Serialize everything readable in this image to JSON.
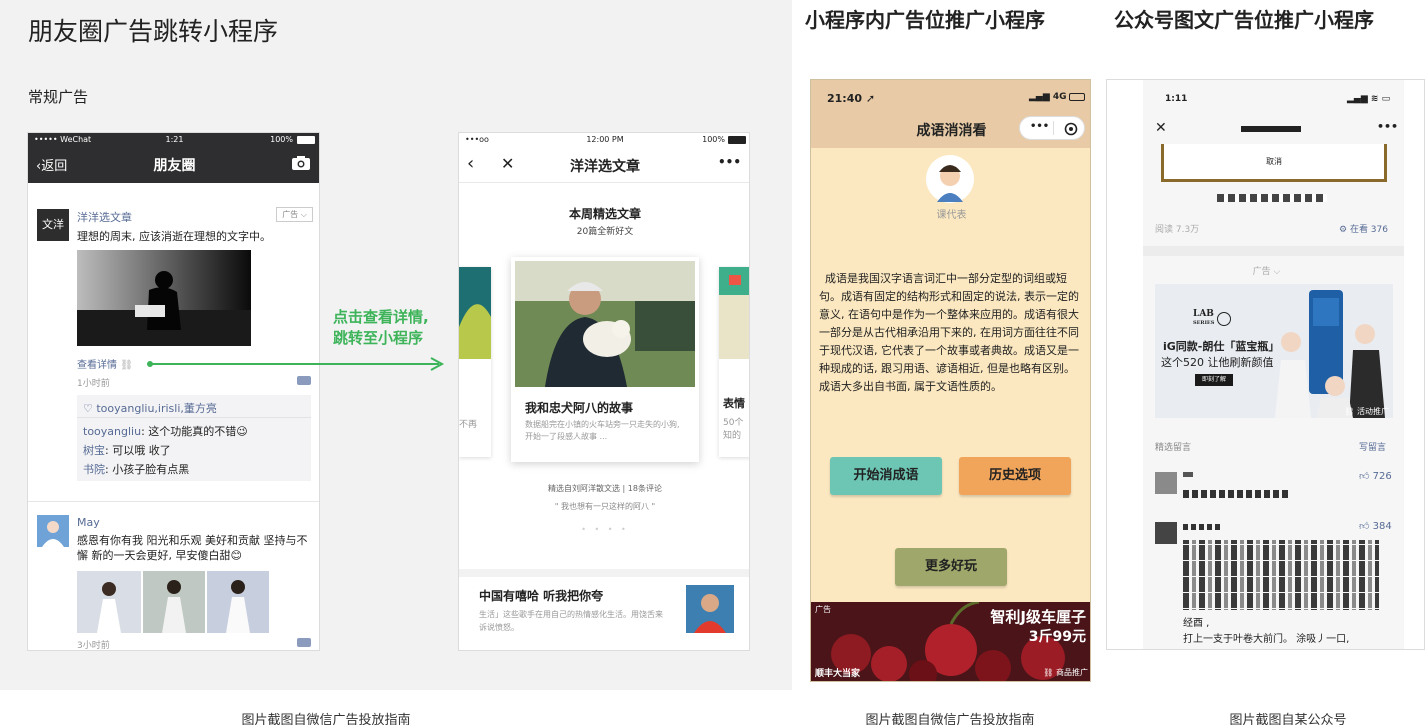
{
  "main_title": "朋友圈广告跳转小程序",
  "sub_title": "常规广告",
  "arrow_text": [
    "点击查看详情,",
    "跳转至小程序"
  ],
  "heading_miniprogram": "小程序内广告位推广小程序",
  "heading_official": "公众号图文广告位推广小程序",
  "captions": [
    "图片截图自微信广告投放指南",
    "图片截图自微信广告投放指南",
    "图片截图自某公众号"
  ],
  "phone1": {
    "status_carrier": "••••• WeChat",
    "status_time": "1:21",
    "status_battery": "100%",
    "back_label": "返回",
    "nav_title": "朋友圈",
    "ad_avatar_text": "文洋",
    "ad_account": "洋洋选文章",
    "ad_badge": "广告",
    "ad_text": "理想的周末, 应该消逝在理想的文字中。",
    "view_details": "查看详情",
    "time_ago": "1小时前",
    "likes": "tooyangliu,irisli,董方亮",
    "comments": [
      {
        "user": "tooyangliu",
        "text": ": 这个功能真的不错😉"
      },
      {
        "user": "树宝",
        "text": ": 可以哦 收了"
      },
      {
        "user": "书院",
        "text": ": 小孩子脸有点黑"
      }
    ],
    "post2_user": "May",
    "post2_text": "感恩有你有我 阳光和乐观 美好和贡献 坚持与不懈 新的一天会更好, 早安傻白甜😊",
    "post2_time": "3小时前"
  },
  "phone2": {
    "status_carrier": "•••oo",
    "status_time": "12:00 PM",
    "status_battery": "100%",
    "nav_title": "洋洋选文章",
    "section_title": "本周精选文章",
    "section_sub": "20篇全新好文",
    "card_title": "我和忠犬阿八的故事",
    "card_desc": "数据船完在小镇的火车站旁一只走失的小狗, 开始一了段感人故事 ...",
    "side_left_text": "不再",
    "side_right_title": "表情",
    "side_right_text": "50个知的",
    "meta": "精选自刘阿洋散文选 | 18条评论",
    "quote": "\" 我也想有一只这样的阿八 \"",
    "article2_title": "中国有嘻哈 听我把你夸",
    "article2_desc": "生活」这些歌手在用自己的热情感化生活。用饶舌来诉说愤怒。"
  },
  "phone3": {
    "status_time": "21:40",
    "status_signal": "4G",
    "nav_title": "成语消消看",
    "avatar_caption": "课代表",
    "body_text": "成语是我国汉字语言词汇中一部分定型的词组或短句。成语有固定的结构形式和固定的说法, 表示一定的意义, 在语句中是作为一个整体来应用的。成语有很大一部分是从古代相承沿用下来的, 在用词方面往往不同于现代汉语, 它代表了一个故事或者典故。成语又是一种现成的话, 跟习用语、谚语相近, 但是也略有区别。成语大多出自书面, 属于文语性质的。",
    "btn_start": "开始消成语",
    "btn_history": "历史选项",
    "btn_more": "更多好玩",
    "ad_label": "广告",
    "ad_headline": "智利J级车厘子",
    "ad_price": "3斤99元",
    "ad_brand": "顺丰大当家",
    "ad_tag": "商品推广"
  },
  "phone4": {
    "status_time": "1:11",
    "cancel_label": "取消",
    "read_count": "阅读 7.3万",
    "in_view": "在看 376",
    "ad_label": "广告",
    "ad_brand1": "LAB",
    "ad_brand2": "SERIES",
    "ad_line1": "iG同款-朗仕「蓝宝瓶」",
    "ad_line2": "这个520 让他刷新颜值",
    "ad_button": "即刻了解",
    "ad_tag": "活动推广",
    "comments_header": "精选留言",
    "write_comment": "写留言",
    "comment1_likes": "726",
    "comment2_likes": "384",
    "comment2_tail1": "经酉 ,",
    "comment2_tail2": "打上一支于叶卷大前门。 涂吸丿一口,"
  },
  "colors": {
    "wechat_dark": "#2e2e30",
    "link_blue": "#576b95",
    "green_arrow": "#3eb45a",
    "btn_teal": "#6cc6b3",
    "btn_orange": "#f0a55a",
    "btn_olive": "#9fa86a"
  }
}
